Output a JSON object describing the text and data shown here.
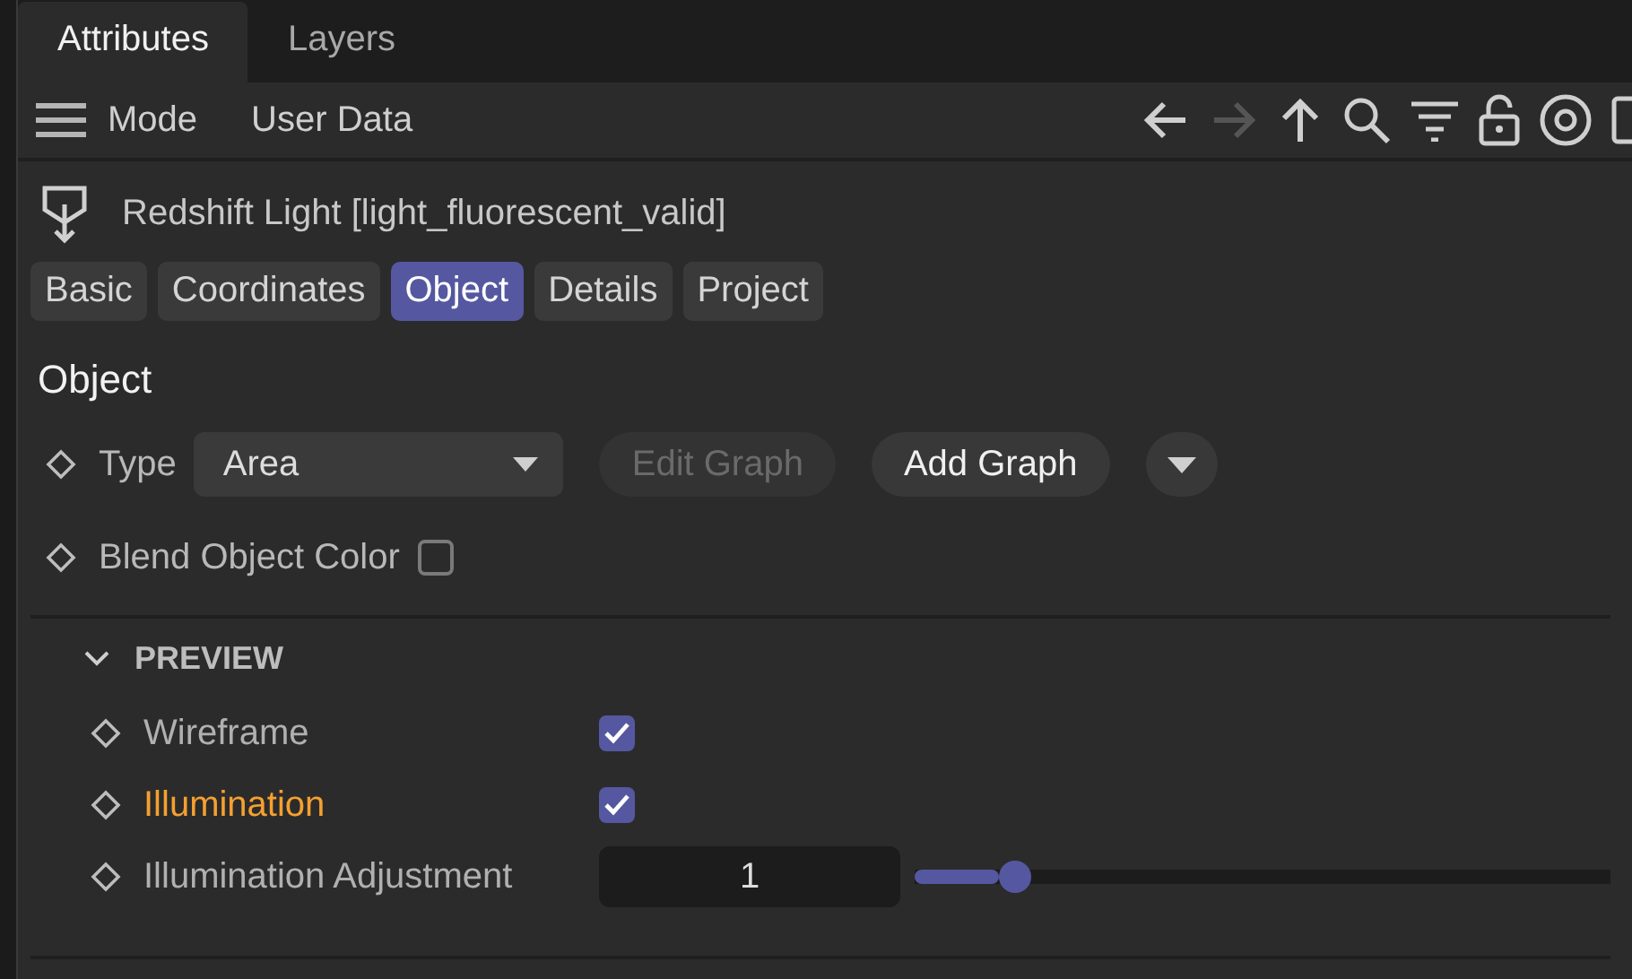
{
  "panel_tabs": [
    {
      "label": "Attributes",
      "selected": true
    },
    {
      "label": "Layers",
      "selected": false
    }
  ],
  "toolbar": {
    "menus": [
      "Mode",
      "User Data"
    ],
    "icons": [
      {
        "kind": "back",
        "disabled": false
      },
      {
        "kind": "forward",
        "disabled": true
      },
      {
        "kind": "up",
        "disabled": false
      },
      {
        "kind": "search",
        "disabled": false
      },
      {
        "kind": "filter",
        "disabled": false
      },
      {
        "kind": "lock",
        "disabled": false
      },
      {
        "kind": "target",
        "disabled": false
      },
      {
        "kind": "panel",
        "disabled": false
      }
    ]
  },
  "object_title": "Redshift Light [light_fluorescent_valid]",
  "tabs": [
    {
      "label": "Basic",
      "selected": false
    },
    {
      "label": "Coordinates",
      "selected": false
    },
    {
      "label": "Object",
      "selected": true
    },
    {
      "label": "Details",
      "selected": false
    },
    {
      "label": "Project",
      "selected": false
    }
  ],
  "section_title": "Object",
  "type_row": {
    "label": "Type",
    "value": "Area",
    "buttons": [
      {
        "label": "Edit Graph",
        "disabled": true
      },
      {
        "label": "Add Graph",
        "disabled": false
      }
    ]
  },
  "blend_row": {
    "label": "Blend Object Color",
    "checked": false
  },
  "preview": {
    "title": "PREVIEW",
    "expanded": true,
    "rows": [
      {
        "kind": "checkbox",
        "label": "Wireframe",
        "highlighted": false,
        "checked": true
      },
      {
        "kind": "checkbox",
        "label": "Illumination",
        "highlighted": true,
        "checked": true
      },
      {
        "kind": "slider",
        "label": "Illumination Adjustment",
        "highlighted": false,
        "value": "1",
        "level": 0.12
      }
    ]
  }
}
